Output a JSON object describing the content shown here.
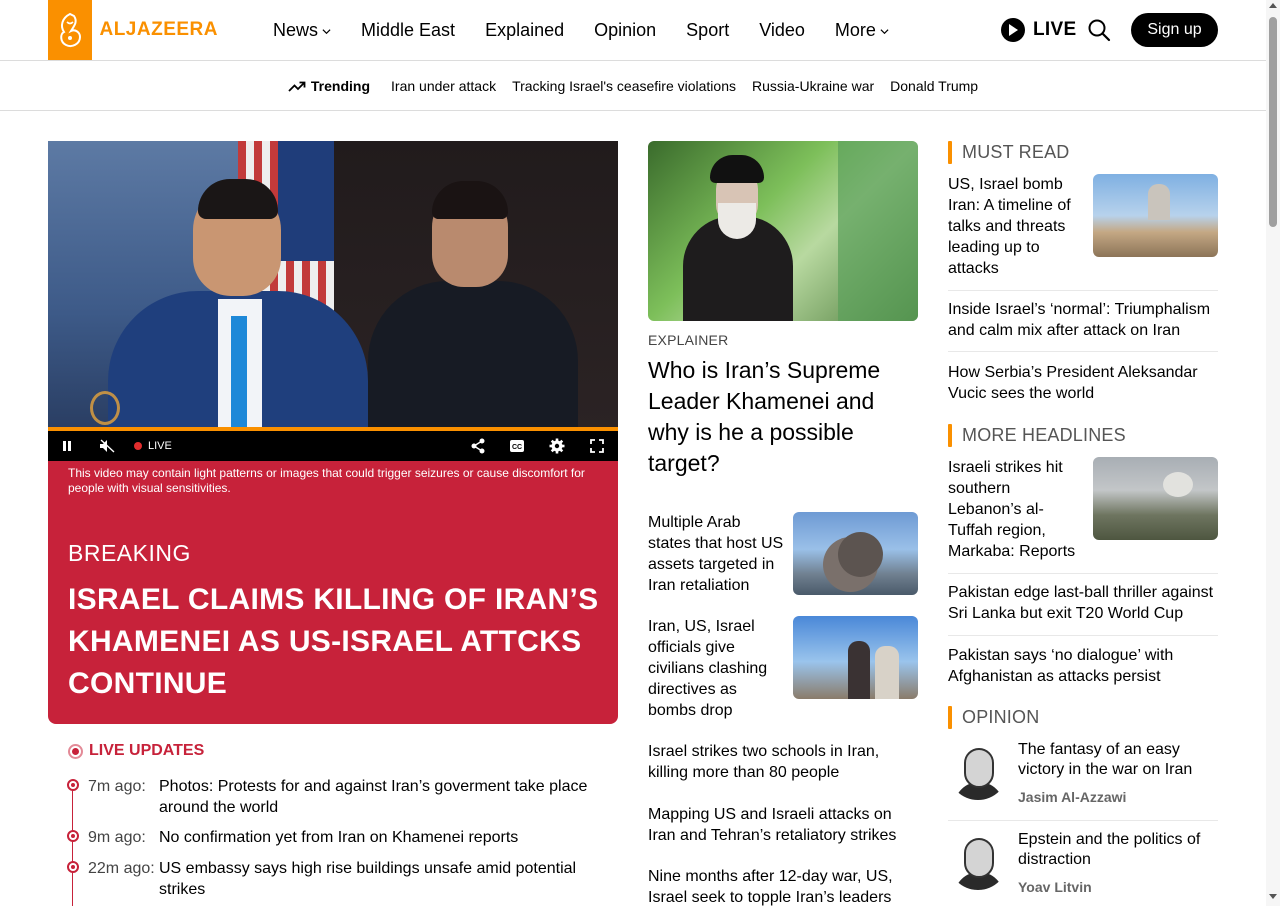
{
  "brand": {
    "name": "ALJAZEERA",
    "accent": "#fa9000",
    "breaking_red": "#c7223a"
  },
  "nav": {
    "items": [
      {
        "label": "News",
        "dropdown": true
      },
      {
        "label": "Middle East",
        "dropdown": false
      },
      {
        "label": "Explained",
        "dropdown": false
      },
      {
        "label": "Opinion",
        "dropdown": false
      },
      {
        "label": "Sport",
        "dropdown": false
      },
      {
        "label": "Video",
        "dropdown": false
      },
      {
        "label": "More",
        "dropdown": true
      }
    ],
    "live_label": "LIVE",
    "search_icon": "search-icon",
    "signup_label": "Sign up"
  },
  "trending": {
    "label": "Trending",
    "links": [
      "Iran under attack",
      "Tracking Israel's ceasefire violations",
      "Russia-Ukraine war",
      "Donald Trump"
    ]
  },
  "video": {
    "live_label": "LIVE",
    "disclaimer": "This video may contain light patterns or images that could trigger seizures or cause discomfort for people with visual sensitivities."
  },
  "breaking": {
    "label": "BREAKING",
    "title": "ISRAEL CLAIMS KILLING OF IRAN’S KHAMENEI AS US-ISRAEL ATTCKS CONTINUE"
  },
  "live_updates": {
    "heading": "LIVE UPDATES",
    "items": [
      {
        "time": "7m ago:",
        "text": "Photos: Protests for and against Iran’s goverment take place around the world"
      },
      {
        "time": "9m ago:",
        "text": "No confirmation yet from Iran on Khamenei reports"
      },
      {
        "time": "22m ago:",
        "text": "US embassy says high rise buildings unsafe amid potential strikes"
      }
    ]
  },
  "middle": {
    "kicker": "EXPLAINER",
    "headline": "Who is Iran’s Supreme Leader Khamenei and why is he a possible target?",
    "rows": [
      {
        "text": "Multiple Arab states that host US assets targeted in Iran retaliation"
      },
      {
        "text": "Iran, US, Israel officials give civilians clashing directives as bombs drop"
      }
    ],
    "links": [
      "Israel strikes two schools in Iran, killing more than 80 people",
      "Mapping US and Israeli attacks on Iran and Tehran’s retaliatory strikes",
      "Nine months after 12-day war, US, Israel seek to topple Iran’s leaders"
    ]
  },
  "must_read": {
    "heading": "MUST READ",
    "feature": "US, Israel bomb Iran: A timeline of talks and threats leading up to attacks",
    "links": [
      "Inside Israel’s ‘normal’: Triumphalism and calm mix after attack on Iran",
      "How Serbia’s President Aleksandar Vucic sees the world"
    ]
  },
  "more_headlines": {
    "heading": "MORE HEADLINES",
    "feature": "Israeli strikes hit southern Lebanon’s al-Tuffah region, Markaba: Reports",
    "links": [
      "Pakistan edge last-ball thriller against Sri Lanka but exit T20 World Cup",
      "Pakistan says ‘no dialogue’ with Afghanistan as attacks persist"
    ]
  },
  "opinion": {
    "heading": "OPINION",
    "items": [
      {
        "title": "The fantasy of an easy victory in the war on Iran",
        "author": "Jasim Al-Azzawi"
      },
      {
        "title": "Epstein and the politics of distraction",
        "author": "Yoav Litvin"
      }
    ]
  }
}
